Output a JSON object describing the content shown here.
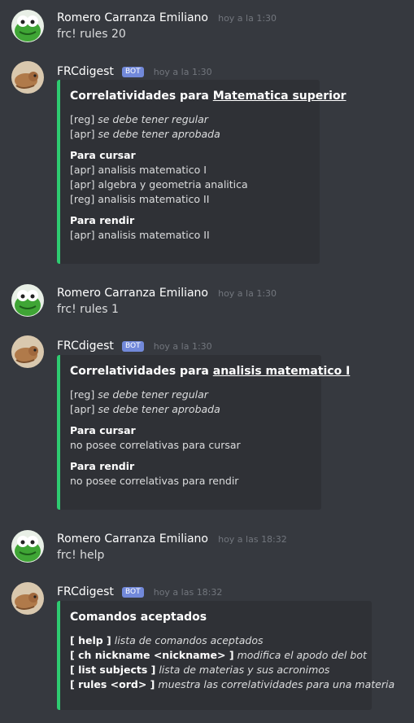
{
  "colors": {
    "background": "#36393f",
    "embed_bg": "#2f3136",
    "embed_border": "#2ecc71",
    "bot_tag": "#7289da",
    "timestamp": "#72767d"
  },
  "messages": [
    {
      "author": "Romero Carranza Emiliano",
      "timestamp": "hoy a la 1:30",
      "avatar_icon": "kermit-avatar-icon",
      "text": "frc! rules 20"
    },
    {
      "author": "FRCdigest",
      "bot_tag": "BOT",
      "timestamp": "hoy a la 1:30",
      "avatar_icon": "lizard-avatar-icon",
      "embed": {
        "title_prefix": "Correlatividades para ",
        "title_link": "Matematica superior",
        "legend": [
          {
            "code": "[reg]",
            "desc": "se debe tener regular"
          },
          {
            "code": "[apr]",
            "desc": "se debe tener aprobada"
          }
        ],
        "fields": [
          {
            "name": "Para cursar",
            "lines": [
              "[apr] analisis matematico I",
              "[apr] algebra y geometria analitica",
              "[reg] analisis matematico II"
            ]
          },
          {
            "name": "Para rendir",
            "lines": [
              "[apr] analisis matematico II"
            ]
          }
        ]
      }
    },
    {
      "author": "Romero Carranza Emiliano",
      "timestamp": "hoy a la 1:30",
      "avatar_icon": "kermit-avatar-icon",
      "text": "frc! rules 1"
    },
    {
      "author": "FRCdigest",
      "bot_tag": "BOT",
      "timestamp": "hoy a la 1:30",
      "avatar_icon": "lizard-avatar-icon",
      "embed": {
        "title_prefix": "Correlatividades para ",
        "title_link": "analisis matematico I",
        "legend": [
          {
            "code": "[reg]",
            "desc": "se debe tener regular"
          },
          {
            "code": "[apr]",
            "desc": "se debe tener aprobada"
          }
        ],
        "fields": [
          {
            "name": "Para cursar",
            "lines": [
              "no posee correlativas para cursar"
            ]
          },
          {
            "name": "Para rendir",
            "lines": [
              "no posee correlativas para rendir"
            ]
          }
        ]
      }
    },
    {
      "author": "Romero Carranza Emiliano",
      "timestamp": "hoy a las 18:32",
      "avatar_icon": "kermit-avatar-icon",
      "text": "frc! help"
    },
    {
      "author": "FRCdigest",
      "bot_tag": "BOT",
      "timestamp": "hoy a las 18:32",
      "avatar_icon": "lizard-avatar-icon",
      "embed": {
        "title": "Comandos aceptados",
        "commands": [
          {
            "cmd": "[ help ]",
            "desc": "lista de comandos aceptados"
          },
          {
            "cmd": "[ ch nickname <nickname> ]",
            "desc": "modifica el apodo del bot"
          },
          {
            "cmd": "[ list subjects ]",
            "desc": "lista de materias y sus acronimos"
          },
          {
            "cmd": "[ rules <ord> ]",
            "desc": "muestra las correlatividades para una materia"
          }
        ]
      }
    }
  ]
}
